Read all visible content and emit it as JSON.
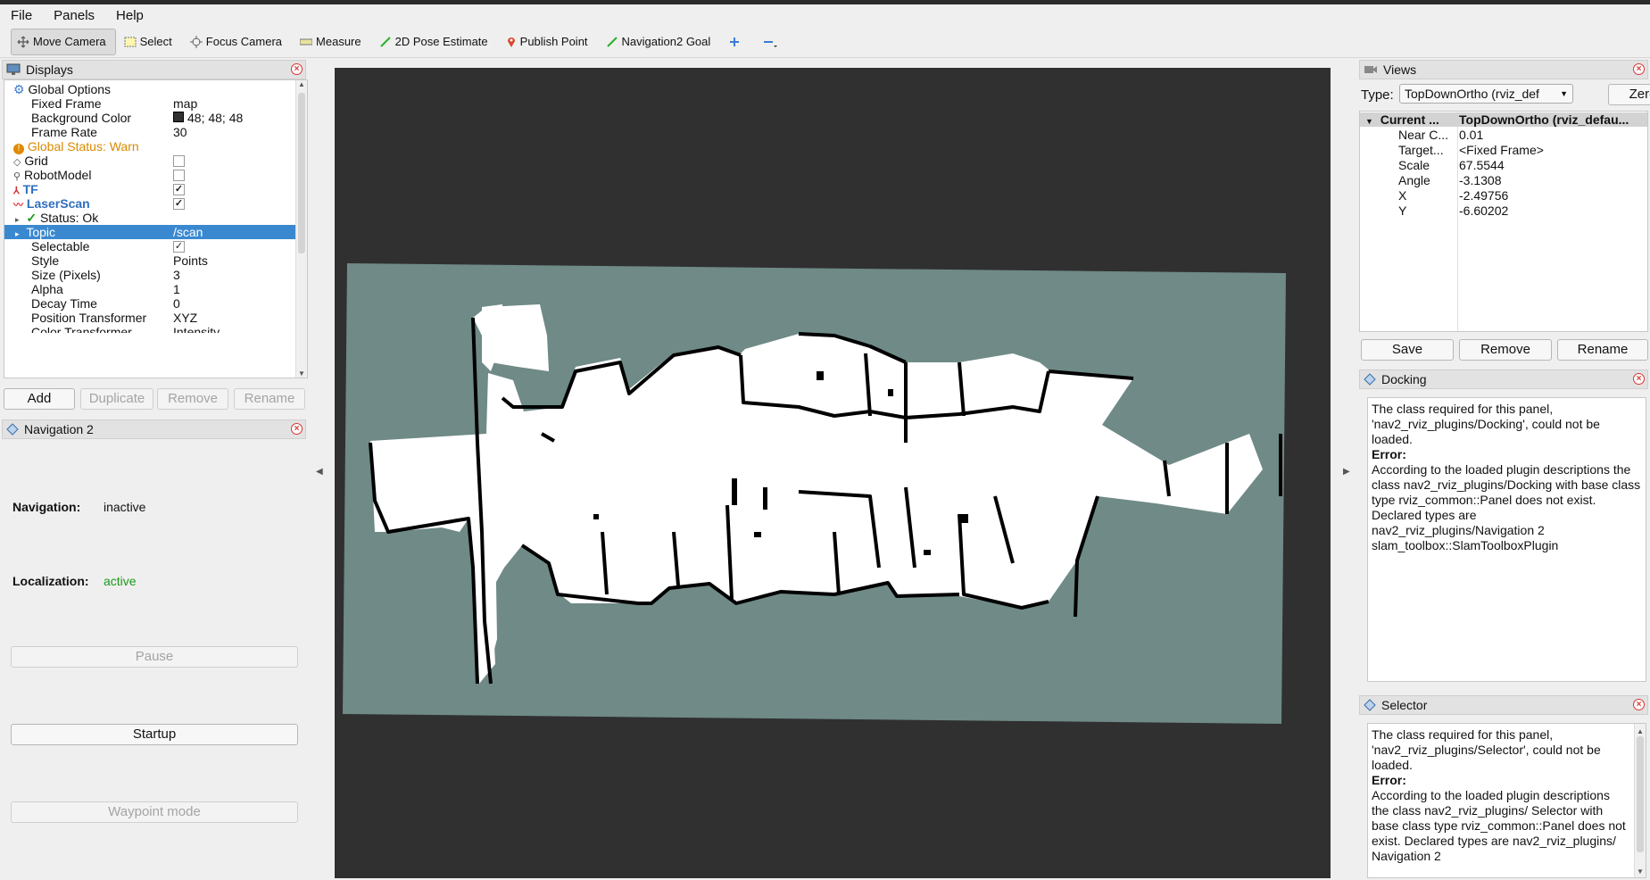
{
  "menu": {
    "file": "File",
    "panels": "Panels",
    "help": "Help"
  },
  "toolbar": {
    "move_camera": "Move Camera",
    "select": "Select",
    "focus_camera": "Focus Camera",
    "measure": "Measure",
    "pose_estimate": "2D Pose Estimate",
    "publish_point": "Publish Point",
    "nav_goal": "Navigation2 Goal"
  },
  "displays": {
    "title": "Displays",
    "rows": [
      {
        "key": "Global Options",
        "value": ""
      },
      {
        "key": "Fixed Frame",
        "value": "map"
      },
      {
        "key": "Background Color",
        "value": "48; 48; 48"
      },
      {
        "key": "Frame Rate",
        "value": "30"
      },
      {
        "key": "Global Status: Warn",
        "value": ""
      },
      {
        "key": "Grid",
        "value": ""
      },
      {
        "key": "RobotModel",
        "value": ""
      },
      {
        "key": "TF",
        "value": ""
      },
      {
        "key": "LaserScan",
        "value": ""
      },
      {
        "key": "Status: Ok",
        "value": ""
      },
      {
        "key": "Topic",
        "value": "/scan"
      },
      {
        "key": "Selectable",
        "value": ""
      },
      {
        "key": "Style",
        "value": "Points"
      },
      {
        "key": "Size (Pixels)",
        "value": "3"
      },
      {
        "key": "Alpha",
        "value": "1"
      },
      {
        "key": "Decay Time",
        "value": "0"
      },
      {
        "key": "Position Transformer",
        "value": "XYZ"
      },
      {
        "key": "Color Transformer",
        "value": "Intensity"
      }
    ],
    "buttons": {
      "add": "Add",
      "duplicate": "Duplicate",
      "remove": "Remove",
      "rename": "Rename"
    }
  },
  "nav2": {
    "title": "Navigation 2",
    "navigation_label": "Navigation:",
    "navigation_value": "inactive",
    "localization_label": "Localization:",
    "localization_value": "active",
    "pause": "Pause",
    "startup": "Startup",
    "waypoint": "Waypoint mode"
  },
  "views": {
    "title": "Views",
    "type_label": "Type:",
    "type_value": "TopDownOrtho (rviz_def",
    "zero": "Zero",
    "header_key": "Current ...",
    "header_value": "TopDownOrtho (rviz_defau...",
    "rows": [
      {
        "key": "Near C...",
        "value": "0.01"
      },
      {
        "key": "Target...",
        "value": "<Fixed Frame>"
      },
      {
        "key": "Scale",
        "value": "67.5544"
      },
      {
        "key": "Angle",
        "value": "-3.1308"
      },
      {
        "key": "X",
        "value": "-2.49756"
      },
      {
        "key": "Y",
        "value": "-6.60202"
      }
    ],
    "save": "Save",
    "remove": "Remove",
    "rename": "Rename"
  },
  "docking": {
    "title": "Docking",
    "msg": "The class required for this panel, 'nav2_rviz_plugins/Docking', could not be loaded.",
    "error_label": "Error:",
    "err": "According to the loaded plugin descriptions the class nav2_rviz_plugins/Docking with base class type rviz_common::Panel does not exist. Declared types are nav2_rviz_plugins/Navigation 2 slam_toolbox::SlamToolboxPlugin"
  },
  "selector": {
    "title": "Selector",
    "msg": "The class required for this panel, 'nav2_rviz_plugins/Selector', could not be loaded.",
    "error_label": "Error:",
    "err": "According to the loaded plugin descriptions the class nav2_rviz_plugins/ Selector with base class type rviz_common::Panel does not exist. Declared types are nav2_rviz_plugins/ Navigation 2"
  },
  "colors": {
    "background": "#303030",
    "map_free": "#ffffff",
    "map_unknown": "#6f8a87",
    "selection": "#3a89d0",
    "warn": "#e08a00",
    "active": "#1a9a1a"
  }
}
